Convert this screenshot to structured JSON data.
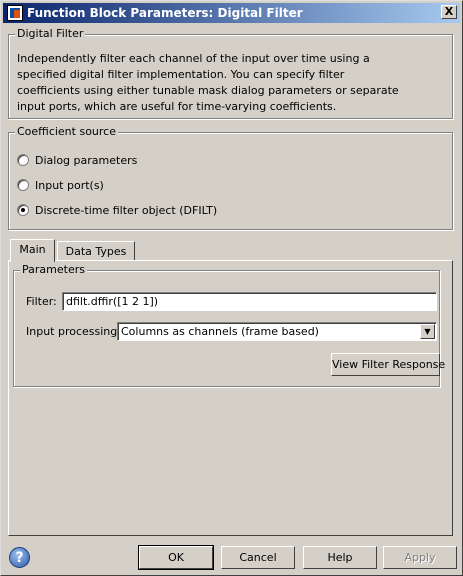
{
  "window": {
    "title": "Function Block Parameters: Digital Filter",
    "close_glyph": "X"
  },
  "digital_filter": {
    "group_label": "Digital Filter",
    "description": "Independently filter each channel of the input over time using a specified digital filter implementation. You can specify filter coefficients using either tunable mask dialog parameters or separate input ports, which are useful for time-varying coefficients."
  },
  "coefficient_source": {
    "group_label": "Coefficient source",
    "options": [
      {
        "label": "Dialog parameters",
        "checked": false
      },
      {
        "label": "Input port(s)",
        "checked": false
      },
      {
        "label": "Discrete-time filter object (DFILT)",
        "checked": true
      }
    ]
  },
  "tabs": [
    {
      "label": "Main",
      "active": true
    },
    {
      "label": "Data Types",
      "active": false
    }
  ],
  "parameters": {
    "group_label": "Parameters",
    "filter_label": "Filter:",
    "filter_value": "dfilt.dffir([1 2 1])",
    "input_processing_label": "Input processing:",
    "input_processing_value": "Columns as channels (frame based)",
    "view_response_label": "View Filter Response"
  },
  "footer": {
    "help_glyph": "?",
    "ok_label": "OK",
    "cancel_label": "Cancel",
    "help_label": "Help",
    "apply_label": "Apply"
  }
}
